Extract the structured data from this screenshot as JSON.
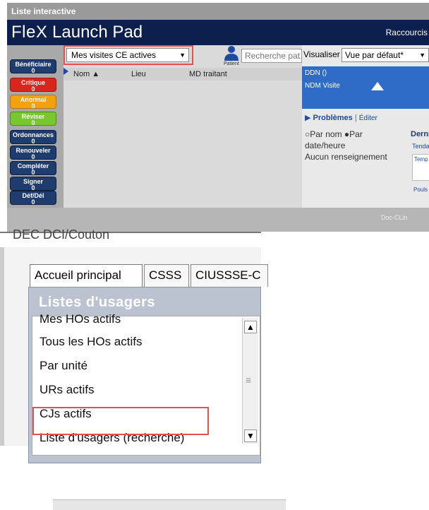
{
  "top": {
    "window_title": "Liste interactive",
    "app_title_flex": "FleX",
    "app_title_rest": " Launch Pad",
    "shortcuts": "Raccourcis",
    "left_buttons": [
      {
        "label": "Bénéficiaire",
        "count": "0"
      },
      {
        "label": "Critique",
        "count": "0"
      },
      {
        "label": "Anormal",
        "count": "0"
      },
      {
        "label": "Réviser",
        "count": "0"
      },
      {
        "label": "Ordonnances",
        "count": "0"
      },
      {
        "label": "Renouveler",
        "count": "0"
      },
      {
        "label": "Compléter",
        "count": "0"
      },
      {
        "label": "Signer",
        "count": "0"
      },
      {
        "label": "Déf/Dél",
        "count": "0"
      }
    ],
    "visit_select": "Mes visites CE actives",
    "patient_label": "Patient",
    "patient_search_placeholder": "Recherche pat",
    "columns": {
      "nom": "Nom ▲",
      "lieu": "Lieu",
      "md": "MD traitant"
    },
    "visualiser_label": "Visualiser",
    "view_select": "Vue par défaut*",
    "ddn": "DDN  ()",
    "ndm": "NDM  Visite",
    "problems": "Problèmes",
    "problems_sep": "|",
    "editer": "Éditer",
    "option_line1": "○Par nom ●Par",
    "option_line2": "date/heure",
    "no_info": "Aucun renseignement",
    "dern_label": "Dernie",
    "tend_label": "Tendanc",
    "temp_label": "Temp",
    "pouls_label": "Pouls",
    "doc_clin": "Doc-CLin",
    "colors": {
      "banner": "#0d1f4c",
      "blue_panel": "#2f6cc8",
      "highlight": "#e25050"
    }
  },
  "bottom": {
    "cut_text": "DEC         DCI/Couton",
    "tabs": [
      "Accueil principal",
      "CSSS",
      "CIUSSSE-C"
    ],
    "lists_title": "Listes d'usagers",
    "items": [
      "Mes HOs actifs",
      "Tous les HOs actifs",
      "Par unité",
      "URs actifs",
      "CJs actifs",
      "Liste d'usagers (recherche)"
    ]
  }
}
